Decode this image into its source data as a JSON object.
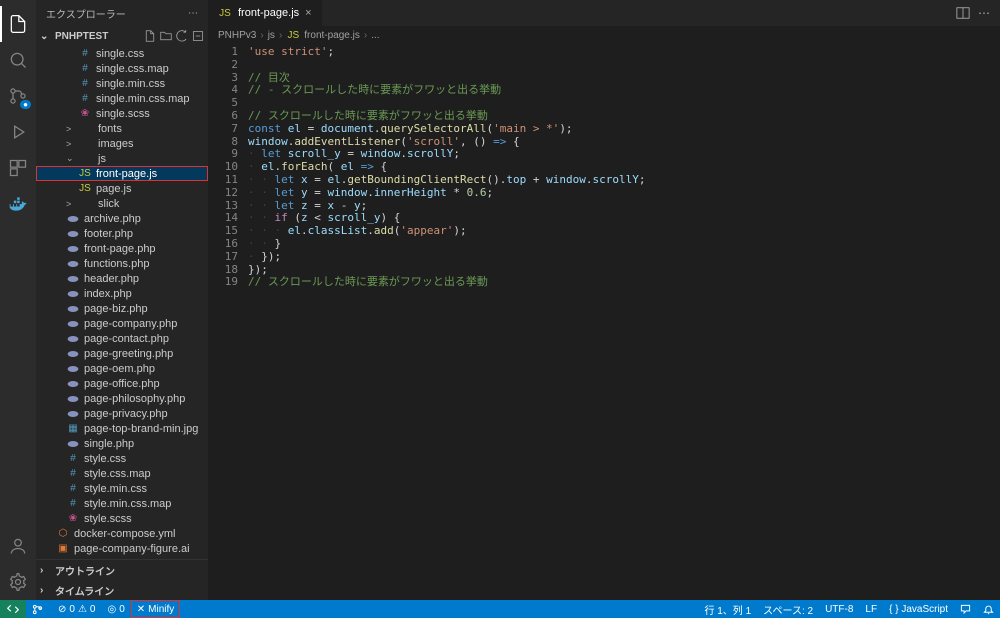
{
  "sidebar": {
    "title": "エクスプローラー",
    "project": "PNHPTEST",
    "outline": "アウトライン",
    "timeline": "タイムライン"
  },
  "tree": [
    {
      "indent": 2,
      "icon": "hash",
      "iconClass": "ic-hash",
      "label": "single.css"
    },
    {
      "indent": 2,
      "icon": "hash",
      "iconClass": "ic-hash",
      "label": "single.css.map"
    },
    {
      "indent": 2,
      "icon": "hash",
      "iconClass": "ic-hash",
      "label": "single.min.css"
    },
    {
      "indent": 2,
      "icon": "hash",
      "iconClass": "ic-hash",
      "label": "single.min.css.map"
    },
    {
      "indent": 2,
      "icon": "scss",
      "iconClass": "ic-scss",
      "label": "single.scss"
    },
    {
      "indent": 1,
      "chev": ">",
      "icon": "",
      "iconClass": "ic-folder",
      "label": "fonts"
    },
    {
      "indent": 1,
      "chev": ">",
      "icon": "",
      "iconClass": "ic-folder",
      "label": "images"
    },
    {
      "indent": 1,
      "chev": "⌄",
      "icon": "",
      "iconClass": "ic-folder",
      "label": "js"
    },
    {
      "indent": 2,
      "icon": "JS",
      "iconClass": "ic-js",
      "label": "front-page.js",
      "selected": true,
      "highlighted": true
    },
    {
      "indent": 2,
      "icon": "JS",
      "iconClass": "ic-js",
      "label": "page.js"
    },
    {
      "indent": 1,
      "chev": ">",
      "icon": "",
      "iconClass": "ic-folder",
      "label": "slick"
    },
    {
      "indent": 1,
      "icon": "php",
      "iconClass": "ic-php",
      "label": "archive.php"
    },
    {
      "indent": 1,
      "icon": "php",
      "iconClass": "ic-php",
      "label": "footer.php"
    },
    {
      "indent": 1,
      "icon": "php",
      "iconClass": "ic-php",
      "label": "front-page.php"
    },
    {
      "indent": 1,
      "icon": "php",
      "iconClass": "ic-php",
      "label": "functions.php"
    },
    {
      "indent": 1,
      "icon": "php",
      "iconClass": "ic-php",
      "label": "header.php"
    },
    {
      "indent": 1,
      "icon": "php",
      "iconClass": "ic-php",
      "label": "index.php"
    },
    {
      "indent": 1,
      "icon": "php",
      "iconClass": "ic-php",
      "label": "page-biz.php"
    },
    {
      "indent": 1,
      "icon": "php",
      "iconClass": "ic-php",
      "label": "page-company.php"
    },
    {
      "indent": 1,
      "icon": "php",
      "iconClass": "ic-php",
      "label": "page-contact.php"
    },
    {
      "indent": 1,
      "icon": "php",
      "iconClass": "ic-php",
      "label": "page-greeting.php"
    },
    {
      "indent": 1,
      "icon": "php",
      "iconClass": "ic-php",
      "label": "page-oem.php"
    },
    {
      "indent": 1,
      "icon": "php",
      "iconClass": "ic-php",
      "label": "page-office.php"
    },
    {
      "indent": 1,
      "icon": "php",
      "iconClass": "ic-php",
      "label": "page-philosophy.php"
    },
    {
      "indent": 1,
      "icon": "php",
      "iconClass": "ic-php",
      "label": "page-privacy.php"
    },
    {
      "indent": 1,
      "icon": "img",
      "iconClass": "ic-img",
      "label": "page-top-brand-min.jpg"
    },
    {
      "indent": 1,
      "icon": "php",
      "iconClass": "ic-php",
      "label": "single.php"
    },
    {
      "indent": 1,
      "icon": "hash",
      "iconClass": "ic-hash",
      "label": "style.css"
    },
    {
      "indent": 1,
      "icon": "hash",
      "iconClass": "ic-hash",
      "label": "style.css.map"
    },
    {
      "indent": 1,
      "icon": "hash",
      "iconClass": "ic-hash",
      "label": "style.min.css"
    },
    {
      "indent": 1,
      "icon": "hash",
      "iconClass": "ic-hash",
      "label": "style.min.css.map"
    },
    {
      "indent": 1,
      "icon": "scss",
      "iconClass": "ic-scss",
      "label": "style.scss"
    },
    {
      "indent": 0,
      "icon": "yml",
      "iconClass": "ic-yml",
      "label": "docker-compose.yml"
    },
    {
      "indent": 0,
      "icon": "ai",
      "iconClass": "ic-ai",
      "label": "page-company-figure.ai"
    }
  ],
  "tab": {
    "label": "front-page.js"
  },
  "breadcrumbs": [
    "PNHPv3",
    "js",
    "front-page.js",
    "..."
  ],
  "jsIcon": "JS",
  "code": {
    "lines": [
      [
        {
          "c": "tk-str",
          "t": "'use strict'"
        },
        {
          "c": "tk-pun",
          "t": ";"
        }
      ],
      [],
      [
        {
          "c": "tk-cmt",
          "t": "// 目次"
        }
      ],
      [
        {
          "c": "tk-cmt",
          "t": "// - スクロールした時に要素がフワッと出る挙動"
        }
      ],
      [],
      [
        {
          "c": "tk-cmt",
          "t": "// スクロールした時に要素がフワッと出る挙動"
        }
      ],
      [
        {
          "c": "tk-kw",
          "t": "const"
        },
        {
          "c": "",
          "t": " "
        },
        {
          "c": "tk-var",
          "t": "el"
        },
        {
          "c": "",
          "t": " = "
        },
        {
          "c": "tk-var",
          "t": "document"
        },
        {
          "c": "",
          "t": "."
        },
        {
          "c": "tk-fn",
          "t": "querySelectorAll"
        },
        {
          "c": "",
          "t": "("
        },
        {
          "c": "tk-str",
          "t": "'main > *'"
        },
        {
          "c": "",
          "t": ");"
        }
      ],
      [
        {
          "c": "tk-var",
          "t": "window"
        },
        {
          "c": "",
          "t": "."
        },
        {
          "c": "tk-fn",
          "t": "addEventListener"
        },
        {
          "c": "",
          "t": "("
        },
        {
          "c": "tk-str",
          "t": "'scroll'"
        },
        {
          "c": "",
          "t": ", () "
        },
        {
          "c": "tk-kw",
          "t": "=>"
        },
        {
          "c": "",
          "t": " {"
        }
      ],
      [
        {
          "c": "tk-pipe",
          "t": "· "
        },
        {
          "c": "tk-kw",
          "t": "let"
        },
        {
          "c": "",
          "t": " "
        },
        {
          "c": "tk-var",
          "t": "scroll_y"
        },
        {
          "c": "",
          "t": " = "
        },
        {
          "c": "tk-var",
          "t": "window"
        },
        {
          "c": "",
          "t": "."
        },
        {
          "c": "tk-var",
          "t": "scrollY"
        },
        {
          "c": "",
          "t": ";"
        }
      ],
      [
        {
          "c": "tk-pipe",
          "t": "· "
        },
        {
          "c": "tk-var",
          "t": "el"
        },
        {
          "c": "",
          "t": "."
        },
        {
          "c": "tk-fn",
          "t": "forEach"
        },
        {
          "c": "",
          "t": "( "
        },
        {
          "c": "tk-var",
          "t": "el"
        },
        {
          "c": "",
          "t": " "
        },
        {
          "c": "tk-kw",
          "t": "=>"
        },
        {
          "c": "",
          "t": " {"
        }
      ],
      [
        {
          "c": "tk-pipe",
          "t": "· · "
        },
        {
          "c": "tk-kw",
          "t": "let"
        },
        {
          "c": "",
          "t": " "
        },
        {
          "c": "tk-var",
          "t": "x"
        },
        {
          "c": "",
          "t": " = "
        },
        {
          "c": "tk-var",
          "t": "el"
        },
        {
          "c": "",
          "t": "."
        },
        {
          "c": "tk-fn",
          "t": "getBoundingClientRect"
        },
        {
          "c": "",
          "t": "()."
        },
        {
          "c": "tk-var",
          "t": "top"
        },
        {
          "c": "",
          "t": " + "
        },
        {
          "c": "tk-var",
          "t": "window"
        },
        {
          "c": "",
          "t": "."
        },
        {
          "c": "tk-var",
          "t": "scrollY"
        },
        {
          "c": "",
          "t": ";"
        }
      ],
      [
        {
          "c": "tk-pipe",
          "t": "· · "
        },
        {
          "c": "tk-kw",
          "t": "let"
        },
        {
          "c": "",
          "t": " "
        },
        {
          "c": "tk-var",
          "t": "y"
        },
        {
          "c": "",
          "t": " = "
        },
        {
          "c": "tk-var",
          "t": "window"
        },
        {
          "c": "",
          "t": "."
        },
        {
          "c": "tk-var",
          "t": "innerHeight"
        },
        {
          "c": "",
          "t": " * "
        },
        {
          "c": "tk-num",
          "t": "0.6"
        },
        {
          "c": "",
          "t": ";"
        }
      ],
      [
        {
          "c": "tk-pipe",
          "t": "· · "
        },
        {
          "c": "tk-kw",
          "t": "let"
        },
        {
          "c": "",
          "t": " "
        },
        {
          "c": "tk-var",
          "t": "z"
        },
        {
          "c": "",
          "t": " = "
        },
        {
          "c": "tk-var",
          "t": "x"
        },
        {
          "c": "",
          "t": " - "
        },
        {
          "c": "tk-var",
          "t": "y"
        },
        {
          "c": "",
          "t": ";"
        }
      ],
      [
        {
          "c": "tk-pipe",
          "t": "· · "
        },
        {
          "c": "tk-kw2",
          "t": "if"
        },
        {
          "c": "",
          "t": " ("
        },
        {
          "c": "tk-var",
          "t": "z"
        },
        {
          "c": "",
          "t": " < "
        },
        {
          "c": "tk-var",
          "t": "scroll_y"
        },
        {
          "c": "",
          "t": ") {"
        }
      ],
      [
        {
          "c": "tk-pipe",
          "t": "· · · "
        },
        {
          "c": "tk-var",
          "t": "el"
        },
        {
          "c": "",
          "t": "."
        },
        {
          "c": "tk-var",
          "t": "classList"
        },
        {
          "c": "",
          "t": "."
        },
        {
          "c": "tk-fn",
          "t": "add"
        },
        {
          "c": "",
          "t": "("
        },
        {
          "c": "tk-str",
          "t": "'appear'"
        },
        {
          "c": "",
          "t": ");"
        }
      ],
      [
        {
          "c": "tk-pipe",
          "t": "· · "
        },
        {
          "c": "",
          "t": "}"
        }
      ],
      [
        {
          "c": "tk-pipe",
          "t": "· "
        },
        {
          "c": "",
          "t": "});"
        }
      ],
      [
        {
          "c": "",
          "t": "});"
        }
      ],
      [
        {
          "c": "tk-cmt",
          "t": "// スクロールした時に要素がフワッと出る挙動"
        }
      ]
    ]
  },
  "status": {
    "branch": "",
    "errors": "0",
    "warnings": "0",
    "ports": "0",
    "minify": "Minify",
    "lncol": "行 1、列 1",
    "spaces": "スペース: 2",
    "encoding": "UTF-8",
    "eol": "LF",
    "lang": "{ } JavaScript"
  }
}
